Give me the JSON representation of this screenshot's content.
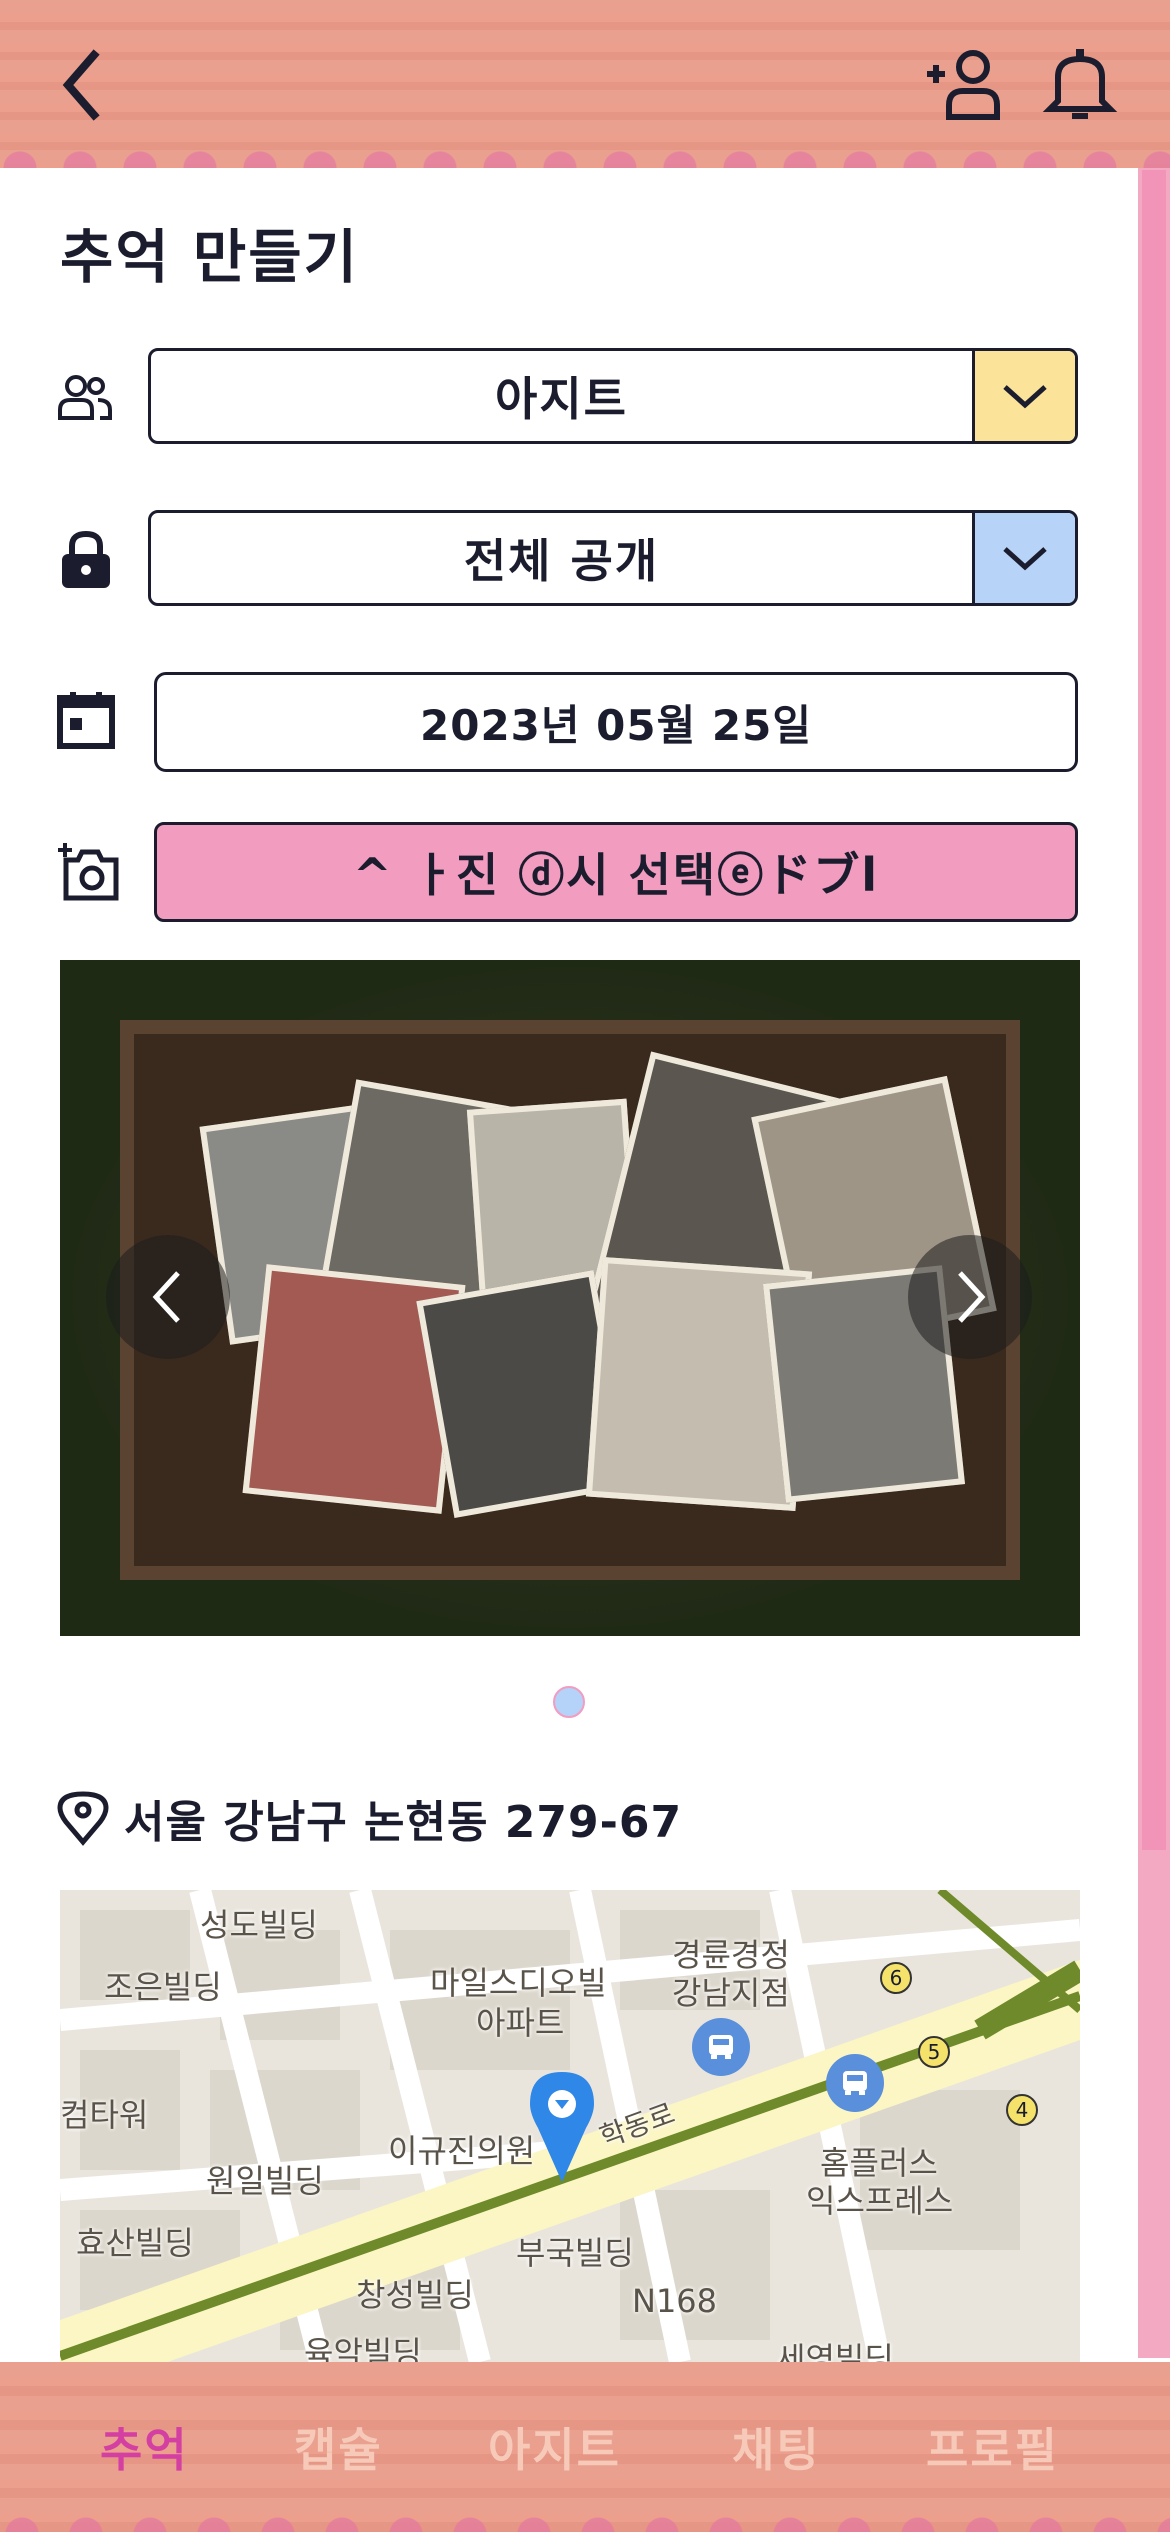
{
  "page": {
    "title": "추억 만들기"
  },
  "group_select": {
    "value": "아지트",
    "accent": "#fbe39a"
  },
  "visibility_select": {
    "value": "전체 공개",
    "accent": "#b7d3f7"
  },
  "date_field": {
    "value": "2023년 05월 25일"
  },
  "photo_button": {
    "label": "^ ㅏ진 ⓓ시 선택ⓔドブl"
  },
  "carousel": {
    "current": 1,
    "total": 1
  },
  "location": {
    "address": "서울 강남구 논현동 279-67"
  },
  "map": {
    "labels": [
      "성도빌딩",
      "조은빌딩",
      "마일스디오빌",
      "아파트",
      "경륜경정",
      "강남지점",
      "컴타워",
      "원일빌딩",
      "이규진의원",
      "학동로",
      "홈플러스",
      "익스프레스",
      "효산빌딩",
      "부국빌딩",
      "창성빌딩",
      "N168",
      "육악빌딩",
      "세영빌딩"
    ],
    "route_badges": [
      "6",
      "5",
      "4"
    ]
  },
  "tabs": [
    {
      "label": "추억",
      "active": true
    },
    {
      "label": "캡슐",
      "active": false
    },
    {
      "label": "아지트",
      "active": false
    },
    {
      "label": "채팅",
      "active": false
    },
    {
      "label": "프로필",
      "active": false
    }
  ],
  "colors": {
    "header_pink": "#e9a08f",
    "active_tab": "#d43fa2",
    "inactive_tab": "#f6c9b9",
    "photo_button": "#f29cc0"
  },
  "icons": {
    "back": "chevron-left-icon",
    "add_friend": "add-person-icon",
    "notifications": "bell-icon",
    "group": "people-icon",
    "privacy": "lock-icon",
    "date": "calendar-icon",
    "camera": "add-camera-icon",
    "location": "location-pin-icon"
  }
}
